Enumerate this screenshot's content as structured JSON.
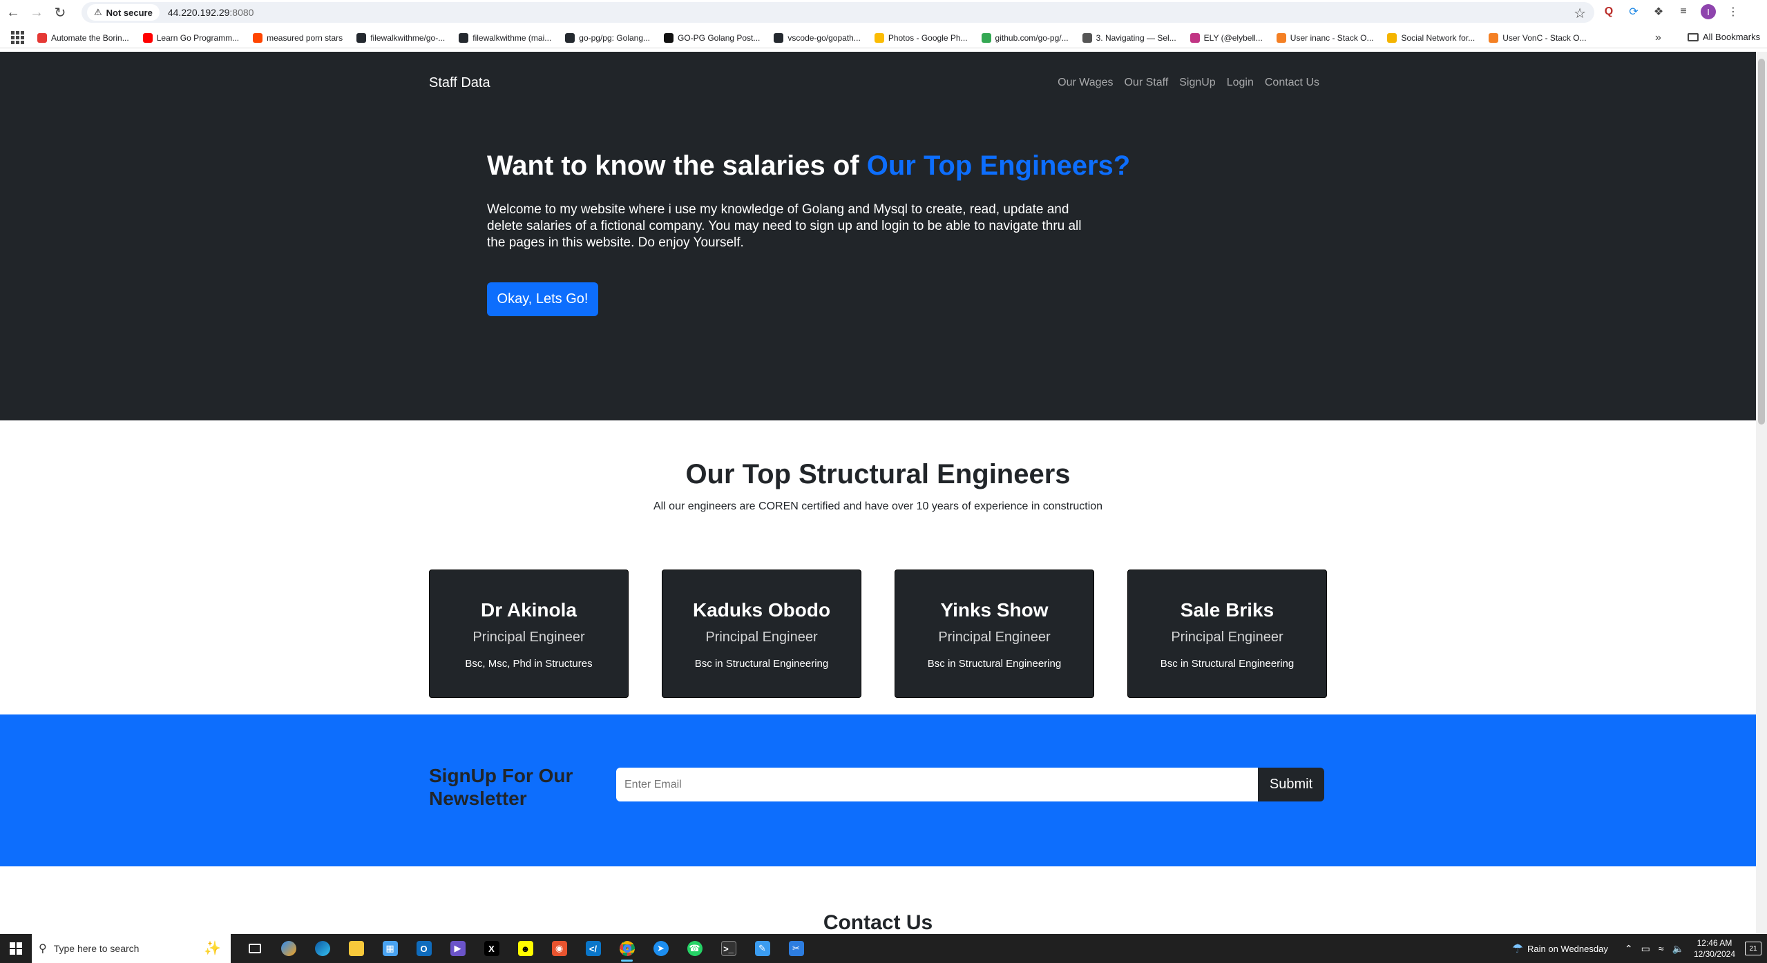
{
  "browser": {
    "security_label": "Not secure",
    "url_host": "44.220.192.29",
    "url_port": ":8080",
    "avatar_letter": "I",
    "bookmarks": [
      {
        "label": "Automate the Borin...",
        "color": "#e53935"
      },
      {
        "label": "Learn Go Programm...",
        "color": "#ff0000"
      },
      {
        "label": "measured porn stars",
        "color": "#ff4500"
      },
      {
        "label": "filewalkwithme/go-...",
        "color": "#24292f"
      },
      {
        "label": "filewalkwithme (mai...",
        "color": "#24292f"
      },
      {
        "label": "go-pg/pg: Golang...",
        "color": "#24292f"
      },
      {
        "label": "GO-PG Golang Post...",
        "color": "#111111"
      },
      {
        "label": "vscode-go/gopath...",
        "color": "#24292f"
      },
      {
        "label": "Photos - Google Ph...",
        "color": "#fbbc04"
      },
      {
        "label": "github.com/go-pg/...",
        "color": "#34a853"
      },
      {
        "label": "3. Navigating — Sel...",
        "color": "#555555"
      },
      {
        "label": "ELY (@elybell...",
        "color": "#c13584"
      },
      {
        "label": "User inanc - Stack O...",
        "color": "#f48024"
      },
      {
        "label": "Social Network for...",
        "color": "#f4b400"
      },
      {
        "label": "User VonC - Stack O...",
        "color": "#f48024"
      }
    ],
    "all_bookmarks_label": "All Bookmarks"
  },
  "page": {
    "brand": "Staff Data",
    "nav": [
      "Our Wages",
      "Our Staff",
      "SignUp",
      "Login",
      "Contact Us"
    ],
    "hero": {
      "title_prefix": "Want to know the salaries of ",
      "title_accent": "Our Top Engineers?",
      "text": "Welcome to my website where i use my knowledge of Golang and Mysql to create, read, update and delete salaries of a fictional company. You may need to sign up and login to be able to navigate thru all the pages in this website. Do enjoy Yourself.",
      "cta_label": "Okay, Lets Go!"
    },
    "team": {
      "title": "Our Top Structural Engineers",
      "subtitle": "All our engineers are COREN certified and have over 10 years of experience in construction",
      "members": [
        {
          "name": "Dr Akinola",
          "role": "Principal Engineer",
          "degree": "Bsc, Msc, Phd in Structures"
        },
        {
          "name": "Kaduks Obodo",
          "role": "Principal Engineer",
          "degree": "Bsc in Structural Engineering"
        },
        {
          "name": "Yinks Show",
          "role": "Principal Engineer",
          "degree": "Bsc in Structural Engineering"
        },
        {
          "name": "Sale Briks",
          "role": "Principal Engineer",
          "degree": "Bsc in Structural Engineering"
        }
      ]
    },
    "newsletter": {
      "title": "SignUp For Our Newsletter",
      "email_placeholder": "Enter Email",
      "submit_label": "Submit"
    },
    "contact_title": "Contact Us"
  },
  "taskbar": {
    "search_placeholder": "Type here to search",
    "weather": "Rain on Wednesday",
    "time": "12:46 AM",
    "date": "12/30/2024",
    "notification_count": "21"
  },
  "colors": {
    "hero_bg": "#212529",
    "accent": "#0d6efd",
    "card_bg": "#212529"
  }
}
